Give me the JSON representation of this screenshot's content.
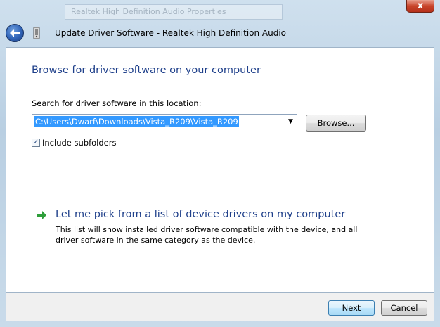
{
  "window": {
    "background_title": "Realtek High Definition Audio Properties",
    "title": "Update Driver Software - Realtek High Definition Audio",
    "close_label": "x"
  },
  "main": {
    "heading": "Browse for driver software on your computer",
    "search_label": "Search for driver software in this location:",
    "path_value": "C:\\Users\\Dwarf\\Downloads\\Vista_R209\\Vista_R209",
    "browse_label": "Browse...",
    "include_subfolders_label": "Include subfolders",
    "include_subfolders_checked": true,
    "pick_title": "Let me pick from a list of device drivers on my computer",
    "pick_description": "This list will show installed driver software compatible with the device, and all driver software in the same category as the device."
  },
  "footer": {
    "next_label": "Next",
    "cancel_label": "Cancel"
  },
  "colors": {
    "heading": "#1e3f8a",
    "selection": "#3399ff",
    "arrow": "#2e9e3a"
  },
  "icons": [
    "back-arrow-icon",
    "device-icon",
    "close-icon",
    "dropdown-arrow-icon",
    "green-arrow-icon",
    "checkmark-icon"
  ]
}
